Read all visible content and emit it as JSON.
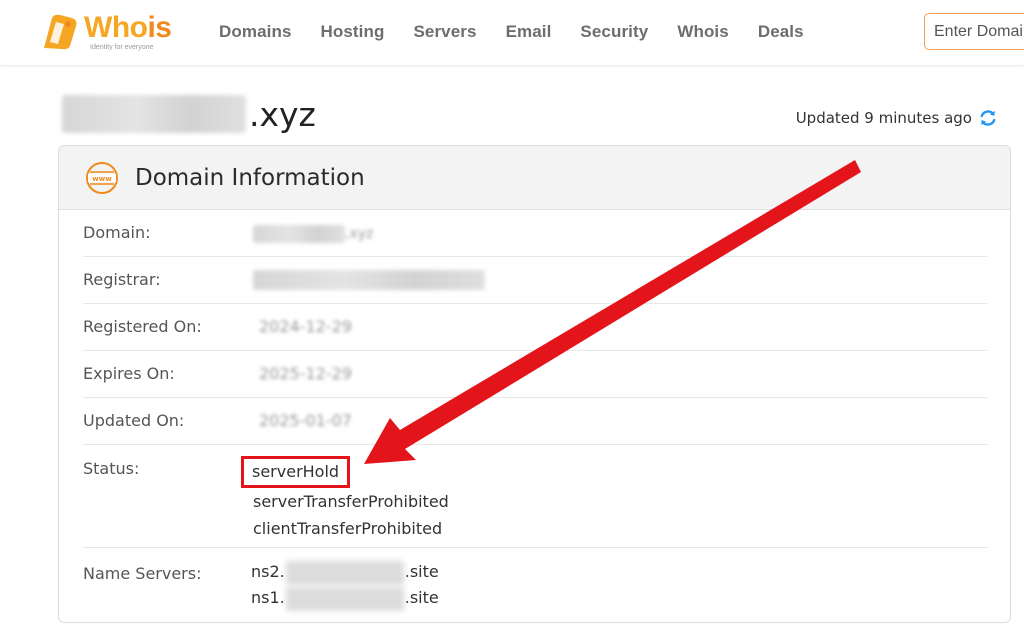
{
  "logo": {
    "name": "Whois",
    "tagline": "Identity for everyone"
  },
  "nav": {
    "items": [
      "Domains",
      "Hosting",
      "Servers",
      "Email",
      "Security",
      "Whois",
      "Deals"
    ]
  },
  "search": {
    "placeholder": "Enter Domain"
  },
  "header": {
    "domain_ext": ".xyz",
    "updated": "Updated 9 minutes ago"
  },
  "panel": {
    "title": "Domain Information",
    "rows": {
      "domain": {
        "label": "Domain:",
        "value": ".xyz"
      },
      "registrar": {
        "label": "Registrar:"
      },
      "registered": {
        "label": "Registered On:",
        "value": "2024-12-29"
      },
      "expires": {
        "label": "Expires On:",
        "value": "2025-12-29"
      },
      "updated": {
        "label": "Updated On:",
        "value": "2025-01-07"
      },
      "status": {
        "label": "Status:",
        "values": [
          "serverHold",
          "serverTransferProhibited",
          "clientTransferProhibited"
        ]
      },
      "nameservers": {
        "label": "Name Servers:",
        "ns2_prefix": "ns2.",
        "ns2_suffix": ".site",
        "ns1_prefix": "ns1.",
        "ns1_suffix": ".site"
      }
    }
  },
  "colors": {
    "brand_orange": "#f5a623",
    "highlight_red": "#e4141b",
    "refresh_blue": "#2196f3"
  }
}
